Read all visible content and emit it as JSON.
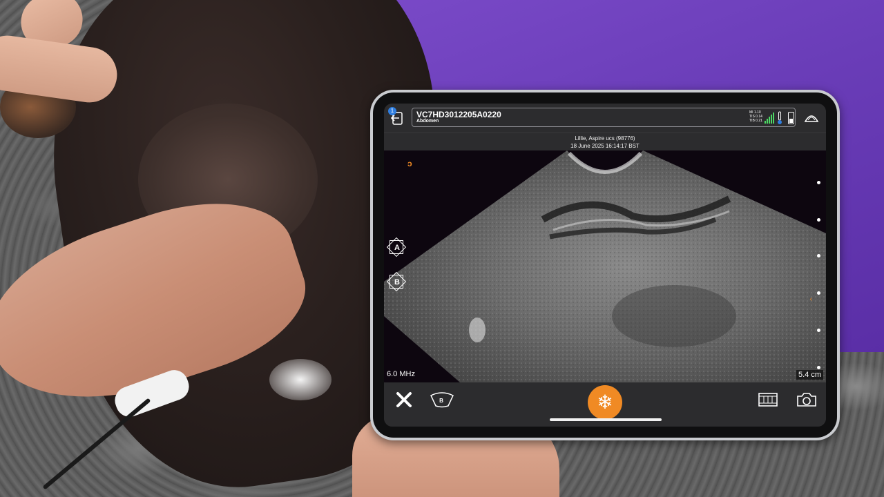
{
  "header": {
    "notification_count": "1",
    "device_id": "VC7HD3012205A0220",
    "preset": "Abdomen",
    "indices": {
      "mi": "MI 1.10",
      "tis": "TIS 0.14",
      "tib": "TIB 0.21"
    }
  },
  "patient": {
    "name": "Lillie, Aspire ucs (98776)",
    "datetime": "18 June 2025 16:14:17 BST"
  },
  "image": {
    "frequency": "6.0 MHz",
    "depth": "5.4 cm",
    "side_buttons": [
      {
        "label": "A"
      },
      {
        "label": "B"
      }
    ]
  },
  "toolbar": {
    "mode_label": "B",
    "freeze_icon": "❄"
  },
  "colors": {
    "accent": "#f08a24",
    "screen_bg": "#2c2c2e",
    "signal": "#4cd964",
    "badge": "#2f7ee0"
  },
  "icons": [
    "back-arrow-icon",
    "signal-bars-icon",
    "thermometer-icon",
    "battery-icon",
    "probe-icon",
    "close-icon",
    "b-mode-icon",
    "snowflake-icon",
    "film-clip-icon",
    "camera-icon"
  ]
}
